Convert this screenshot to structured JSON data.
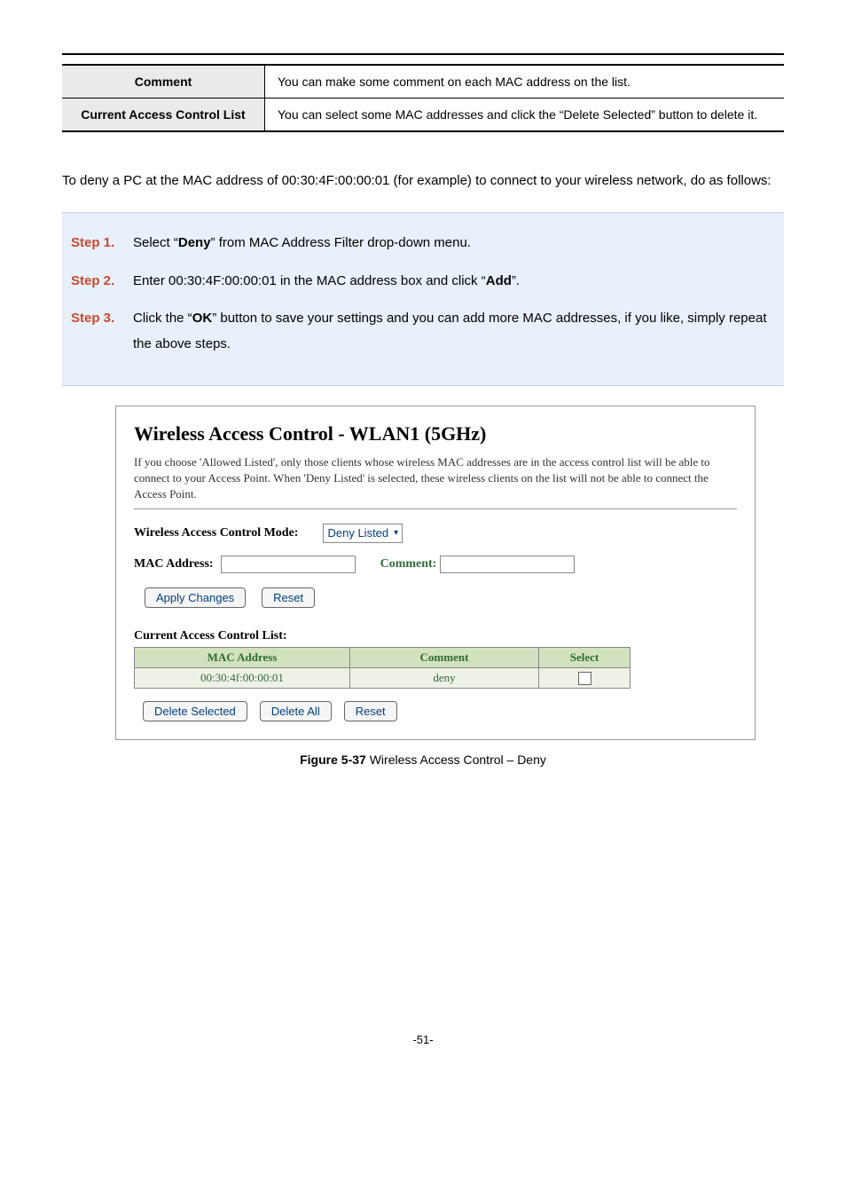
{
  "param_table": {
    "rows": [
      {
        "label": "Comment",
        "desc": "You can make some comment on each MAC address on the list."
      },
      {
        "label": "Current Access Control List",
        "desc": "You can select some MAC addresses and click the “Delete Selected” button to delete it."
      }
    ]
  },
  "body_text": {
    "pre": "To deny a PC at the MAC address of ",
    "mac": "00:30:4F:00:00:01",
    "post": " (for example) to connect to your wireless network, do as follows:"
  },
  "steps": [
    {
      "label": "Step 1.",
      "pre": "Select “",
      "bold": "Deny",
      "post": "” from MAC Address Filter drop-down menu."
    },
    {
      "label": "Step 2.",
      "pre": "Enter 00:30:4F:00:00:01 in the MAC address box and click “",
      "bold": "Add",
      "post": "”."
    },
    {
      "label": "Step 3.",
      "pre": "Click the “",
      "bold": "OK",
      "post": "” button to save your settings and you can add more MAC addresses, if you like, simply repeat the above steps."
    }
  ],
  "shot": {
    "title": "Wireless Access Control - WLAN1 (5GHz)",
    "desc": "If you choose 'Allowed Listed', only those clients whose wireless MAC addresses are in the access control list will be able to connect to your Access Point. When 'Deny Listed' is selected, these wireless clients on the list will not be able to connect the Access Point.",
    "mode_label": "Wireless Access Control Mode:",
    "mode_value": "Deny Listed",
    "mac_label": "MAC Address:",
    "comment_label": "Comment:",
    "apply_btn": "Apply Changes",
    "reset_btn": "Reset",
    "cac_title": "Current Access Control List:",
    "cac_headers": {
      "mac": "MAC Address",
      "comment": "Comment",
      "select": "Select"
    },
    "cac_rows": [
      {
        "mac": "00:30:4f:00:00:01",
        "comment": "deny"
      }
    ],
    "delete_selected_btn": "Delete Selected",
    "delete_all_btn": "Delete All",
    "reset_btn2": "Reset"
  },
  "caption": {
    "bold": "Figure 5-37",
    "rest": " Wireless Access Control – Deny"
  },
  "page_num": "-51-"
}
